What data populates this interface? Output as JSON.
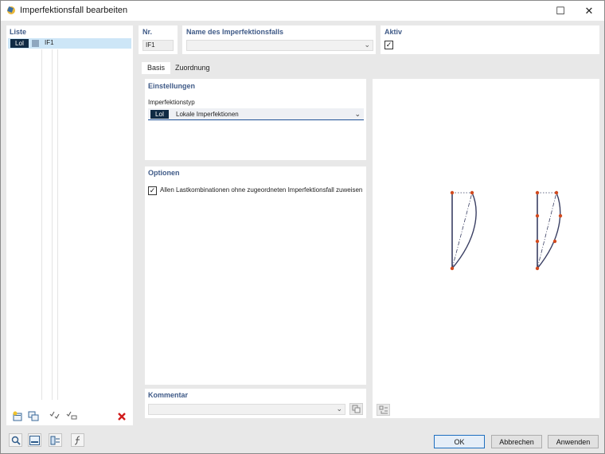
{
  "window": {
    "title": "Imperfektionsfall bearbeiten",
    "maximize_glyph": "☐",
    "close_glyph": "✕"
  },
  "list": {
    "title": "Liste",
    "items": [
      {
        "tag": "LoI",
        "name": "IF1",
        "swatch_color": "#8fa7bf",
        "selected": true
      }
    ]
  },
  "header": {
    "nr_label": "Nr.",
    "nr_value": "IF1",
    "name_label": "Name des Imperfektionsfalls",
    "name_value": "",
    "aktiv_label": "Aktiv",
    "aktiv_checked": true
  },
  "tabs": [
    {
      "label": "Basis",
      "active": true
    },
    {
      "label": "Zuordnung",
      "active": false
    }
  ],
  "einstellungen": {
    "title": "Einstellungen",
    "type_label": "Imperfektionstyp",
    "type_tag": "LoI",
    "type_value": "Lokale Imperfektionen"
  },
  "optionen": {
    "title": "Optionen",
    "checkbox_label": "Allen Lastkombinationen ohne zugeordneten Imperfektionsfall zuweisen",
    "checked": true
  },
  "kommentar": {
    "title": "Kommentar",
    "value": ""
  },
  "buttons": {
    "ok": "OK",
    "cancel": "Abbrechen",
    "apply": "Anwenden"
  },
  "icons": {
    "list_toolbar": [
      "new-item-icon",
      "copy-item-icon",
      "check-all-icon",
      "uncheck-all-icon",
      "delete-icon"
    ],
    "bottom_tools": [
      "search-icon",
      "units-icon",
      "display-icon",
      "function-icon"
    ]
  },
  "colors": {
    "accent": "#3f5a87",
    "tag_bg": "#0f2a44",
    "selection": "#cde6f7",
    "node": "#d24a1e",
    "curve": "#3a3f63",
    "delete": "#d11b1b"
  }
}
